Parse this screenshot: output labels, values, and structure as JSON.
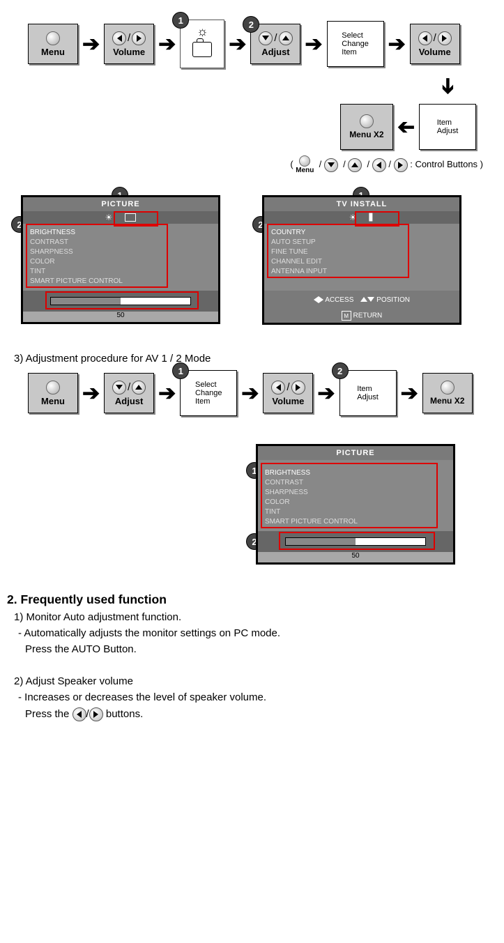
{
  "flow1": {
    "menu": "Menu",
    "volume": "Volume",
    "adjust": "Adjust",
    "select": "Select\nChange\nItem",
    "itemAdjust": "Item\nAdjust",
    "menuX2": "Menu X2"
  },
  "legend": {
    "menu": "Menu",
    "text": ": Control Buttons )"
  },
  "picture_osd": {
    "title": "PICTURE",
    "items": [
      "BRIGHTNESS",
      "CONTRAST",
      "SHARPNESS",
      "COLOR",
      "TINT",
      "SMART PICTURE CONTROL"
    ],
    "value": "50"
  },
  "tv_osd": {
    "title": "TV  INSTALL",
    "items": [
      "COUNTRY",
      "AUTO SETUP",
      "FINE TUNE",
      "CHANNEL EDIT",
      "ANTENNA INPUT"
    ],
    "access": "ACCESS",
    "position": "POSITION",
    "return": "RETURN"
  },
  "section3_title": "3) Adjustment procedure for AV 1 / 2 Mode",
  "picture_osd2": {
    "title": "PICTURE",
    "items": [
      "BRIGHTNESS",
      "CONTRAST",
      "SHARPNESS",
      "COLOR",
      "TINT",
      "SMART PICTURE CONTROL"
    ],
    "value": "50"
  },
  "sec2": {
    "title": "2. Frequently used function",
    "p1": "1) Monitor Auto adjustment function.",
    "p2": "- Automatically adjusts the monitor settings on PC mode.",
    "p3": "Press the AUTO Button.",
    "p4": "2) Adjust Speaker volume",
    "p5": "- Increases or decreases the level of speaker volume.",
    "p6a": "Press the ",
    "p6b": "buttons."
  }
}
